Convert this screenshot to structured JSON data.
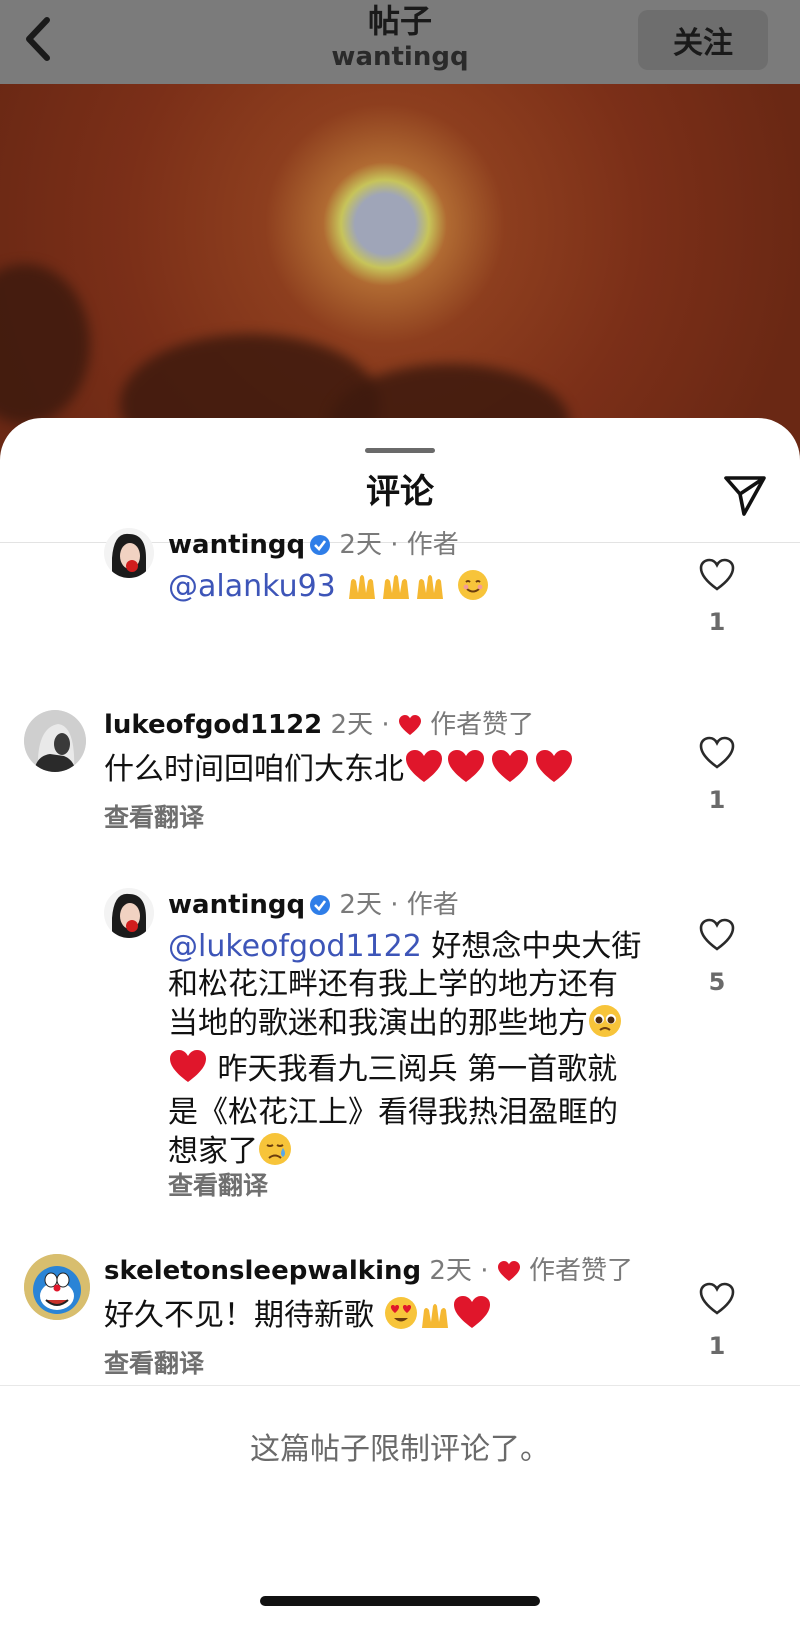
{
  "header": {
    "title": "帖子",
    "username": "wantingq",
    "follow_label": "关注"
  },
  "sheet": {
    "title": "评论"
  },
  "comments": [
    {
      "user": "wantingq",
      "time": "2天",
      "sep": "·",
      "tag": "作者",
      "mention": "@alanku93",
      "likes": "1"
    },
    {
      "user": "lukeofgod1122",
      "time": "2天",
      "sep": "·",
      "tag": "作者赞了",
      "text": "什么时间回咱们大东北",
      "translate": "查看翻译",
      "likes": "1"
    },
    {
      "user": "wantingq",
      "time": "2天",
      "sep": "·",
      "tag": "作者",
      "mention": "@lukeofgod1122",
      "line1": "好想念中央大街",
      "line2": "和松花江畔还有我上学的地方还有",
      "line3": "当地的歌迷和我演出的那些地方",
      "line4": "昨天我看九三阅兵 第一首歌就",
      "line5": "是《松花江上》看得我热泪盈眶的",
      "line6": "想家了",
      "translate": "查看翻译",
      "likes": "5"
    },
    {
      "user": "skeletonsleepwalking",
      "time": "2天",
      "sep": "·",
      "tag": "作者赞了",
      "text": "好久不见！期待新歌",
      "translate": "查看翻译",
      "likes": "1"
    }
  ],
  "footer": {
    "restricted": "这篇帖子限制评论了。"
  },
  "colors": {
    "mention": "#3d55b8",
    "heart_red": "#e0162b",
    "verified_blue": "#2f7ee8"
  },
  "icons": [
    "back-chevron-icon",
    "send-icon",
    "verified-icon",
    "heart-icon",
    "raising-hands-emoji",
    "smiling-emoji",
    "red-heart-emoji",
    "pleading-face-emoji",
    "crying-face-emoji",
    "heart-eyes-emoji"
  ]
}
